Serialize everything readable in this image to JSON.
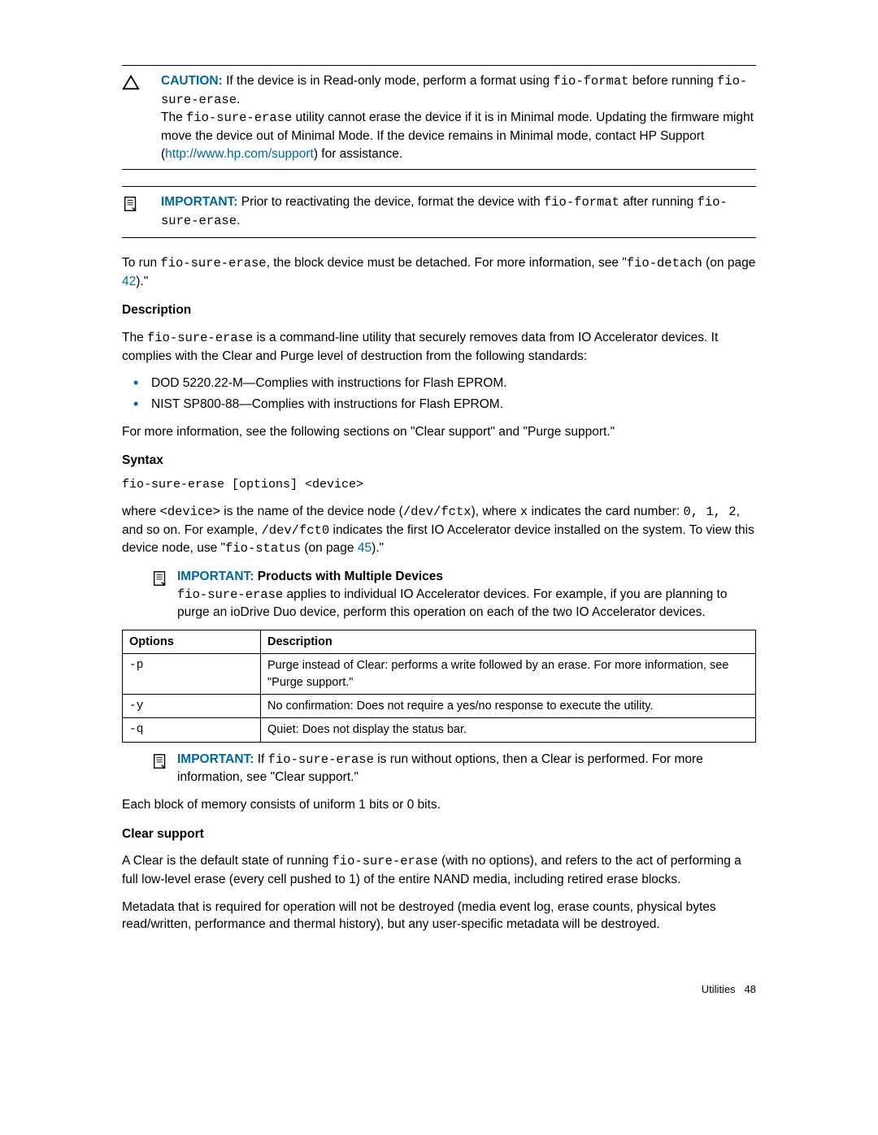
{
  "callout_caution": {
    "label": "CAUTION:",
    "line1_pre": "If the device is in Read-only mode, perform a format using ",
    "cmd1": "fio-format",
    "line1_post": " before running ",
    "cmd2": "fio-sure-erase",
    "line1_end": ".",
    "line2_pre": "The ",
    "cmd3": "fio-sure-erase",
    "line2_mid": " utility cannot erase the device if it is in Minimal mode. Updating the firmware might move the device out of Minimal Mode. If the device remains in Minimal mode, contact HP Support (",
    "link_text": "http://www.hp.com/support",
    "line2_post": ") for assistance."
  },
  "callout_important1": {
    "label": "IMPORTANT:",
    "pre": "Prior to reactivating the device, format the device with ",
    "cmd1": "fio-format",
    "mid": " after running ",
    "cmd2": "fio-sure-erase",
    "end": "."
  },
  "para_detach": {
    "pre": "To run ",
    "cmd": "fio-sure-erase",
    "mid": ", the block device must be detached. For more information, see \"",
    "cmd2": "fio-detach",
    "after_cmd2": " (on page ",
    "page": "42",
    "end": ").\""
  },
  "heading_desc": "Description",
  "para_desc": {
    "pre": "The ",
    "cmd": "fio-sure-erase",
    "post": " is a command-line utility that securely removes data from IO Accelerator devices. It complies with the Clear and Purge level of destruction from the following standards:"
  },
  "bullets": [
    "DOD 5220.22-M—Complies with instructions for Flash EPROM.",
    "NIST SP800-88—Complies with instructions for Flash EPROM."
  ],
  "para_more_info": "For more information, see the following sections on \"Clear support\" and \"Purge support.\"",
  "heading_syntax": "Syntax",
  "syntax_line": "fio-sure-erase [options] <device>",
  "para_where": {
    "pre": "where ",
    "dev": "<device>",
    "t1": " is the name of the device node (",
    "path": "/dev/fctx",
    "t2": "), where ",
    "x": "x",
    "t3": " indicates the card number: ",
    "nums": "0, 1, 2",
    "t4": ", and so on. For example, ",
    "path2": "/dev/fct0",
    "t5": " indicates the first IO Accelerator device installed on the system. To view this device node, use \"",
    "cmd": "fio-status",
    "t6": " (on page ",
    "page": "45",
    "t7": ").\""
  },
  "callout_important2": {
    "label": "IMPORTANT:",
    "title": "Products with Multiple Devices",
    "cmd": "fio-sure-erase",
    "body": " applies to individual IO Accelerator devices. For example, if you are planning to purge an ioDrive Duo device, perform this operation on each of the two IO Accelerator devices."
  },
  "table": {
    "head_opt": "Options",
    "head_desc": "Description",
    "rows": [
      {
        "opt": "-p",
        "desc": "Purge instead of Clear: performs a write followed by an erase. For more information, see \"Purge support.\""
      },
      {
        "opt": "-y",
        "desc": "No confirmation: Does not require a yes/no response to execute the utility."
      },
      {
        "opt": "-q",
        "desc": "Quiet: Does not display the status bar."
      }
    ]
  },
  "callout_important3": {
    "label": "IMPORTANT:",
    "pre": "If ",
    "cmd": "fio-sure-erase",
    "post": " is run without options, then a Clear is performed. For more information, see \"Clear support.\""
  },
  "para_bits": "Each block of memory consists of uniform 1 bits or 0 bits.",
  "heading_clear": "Clear support",
  "para_clear1": {
    "pre": "A Clear is the default state of running ",
    "cmd": "fio-sure-erase",
    "post": " (with no options), and refers to the act of performing a full low-level erase (every cell pushed to 1) of the entire NAND media, including retired erase blocks."
  },
  "para_clear2": "Metadata that is required for operation will not be destroyed (media event log, erase counts, physical bytes read/written, performance and thermal history), but any user-specific metadata will be destroyed.",
  "footer": {
    "section": "Utilities",
    "page": "48"
  }
}
